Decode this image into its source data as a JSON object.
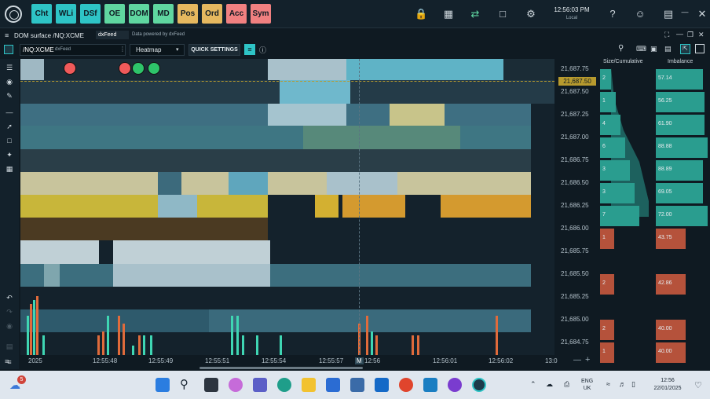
{
  "app_buttons": [
    {
      "label": "Cht",
      "color": "#2ec4c6"
    },
    {
      "label": "WLi",
      "color": "#2ec4c6"
    },
    {
      "label": "DSf",
      "color": "#2ec4c6"
    },
    {
      "label": "OE",
      "color": "#5fd6a0"
    },
    {
      "label": "DOM",
      "color": "#5fd6a0"
    },
    {
      "label": "MD",
      "color": "#5fd6a0"
    },
    {
      "label": "Pos",
      "color": "#e5b85f"
    },
    {
      "label": "Ord",
      "color": "#e5b85f"
    },
    {
      "label": "Acc",
      "color": "#f08080"
    },
    {
      "label": "Sym",
      "color": "#f08080"
    }
  ],
  "clock": {
    "time": "12:56:03 PM",
    "zone": "Local"
  },
  "window": {
    "title": "DOM surface /NQ:XCME",
    "provider_logo": "dxFeed",
    "provider_text": "Data powered by dxFeed"
  },
  "toolbar": {
    "symbol": "/NQ:XCME",
    "feed": "dxFeed",
    "view_select": "Heatmap",
    "quick_settings": "QUICK SETTINGS"
  },
  "price_levels": [
    "21,687.75",
    "21,687.50",
    "21,687.25",
    "21,687.00",
    "21,686.75",
    "21,686.50",
    "21,686.25",
    "21,686.00",
    "21,685.75",
    "21,685.50",
    "21,685.25",
    "21,685.00",
    "21,684.75"
  ],
  "current_price": "21,687.50",
  "dom": {
    "size_header": "Size/Cumulative",
    "imbalance_header": "Imbalance",
    "rows": [
      {
        "size": "2",
        "imb": "57.14",
        "side": "bid"
      },
      {
        "size": "1",
        "imb": "56.25",
        "side": "bid"
      },
      {
        "size": "4",
        "imb": "61.90",
        "side": "bid"
      },
      {
        "size": "6",
        "imb": "88.88",
        "side": "bid"
      },
      {
        "size": "3",
        "imb": "88.89",
        "side": "bid"
      },
      {
        "size": "3",
        "imb": "69.05",
        "side": "bid"
      },
      {
        "size": "7",
        "imb": "72.00",
        "side": "bid"
      },
      {
        "size": "1",
        "imb": "43.75",
        "side": "ask"
      },
      {
        "size": "",
        "imb": "",
        "side": "none"
      },
      {
        "size": "2",
        "imb": "42.86",
        "side": "ask"
      },
      {
        "size": "",
        "imb": "",
        "side": "none"
      },
      {
        "size": "2",
        "imb": "40.00",
        "side": "ask"
      },
      {
        "size": "1",
        "imb": "40.00",
        "side": "ask"
      }
    ]
  },
  "time_labels": [
    "2025",
    "12:55:48",
    "12:55:49",
    "12:55:51",
    "12:55:54",
    "12:55:57",
    "12:56",
    "12:56:01",
    "12:56:02",
    "13:0"
  ],
  "time_marker": "M",
  "taskbar": {
    "notification_count": "5",
    "language": "ENG",
    "region": "UK",
    "time": "12:56",
    "date": "22/01/2025"
  },
  "colors": {
    "bid": "#2a9d8f",
    "ask": "#b5523b",
    "accent": "#2ec4c6"
  }
}
